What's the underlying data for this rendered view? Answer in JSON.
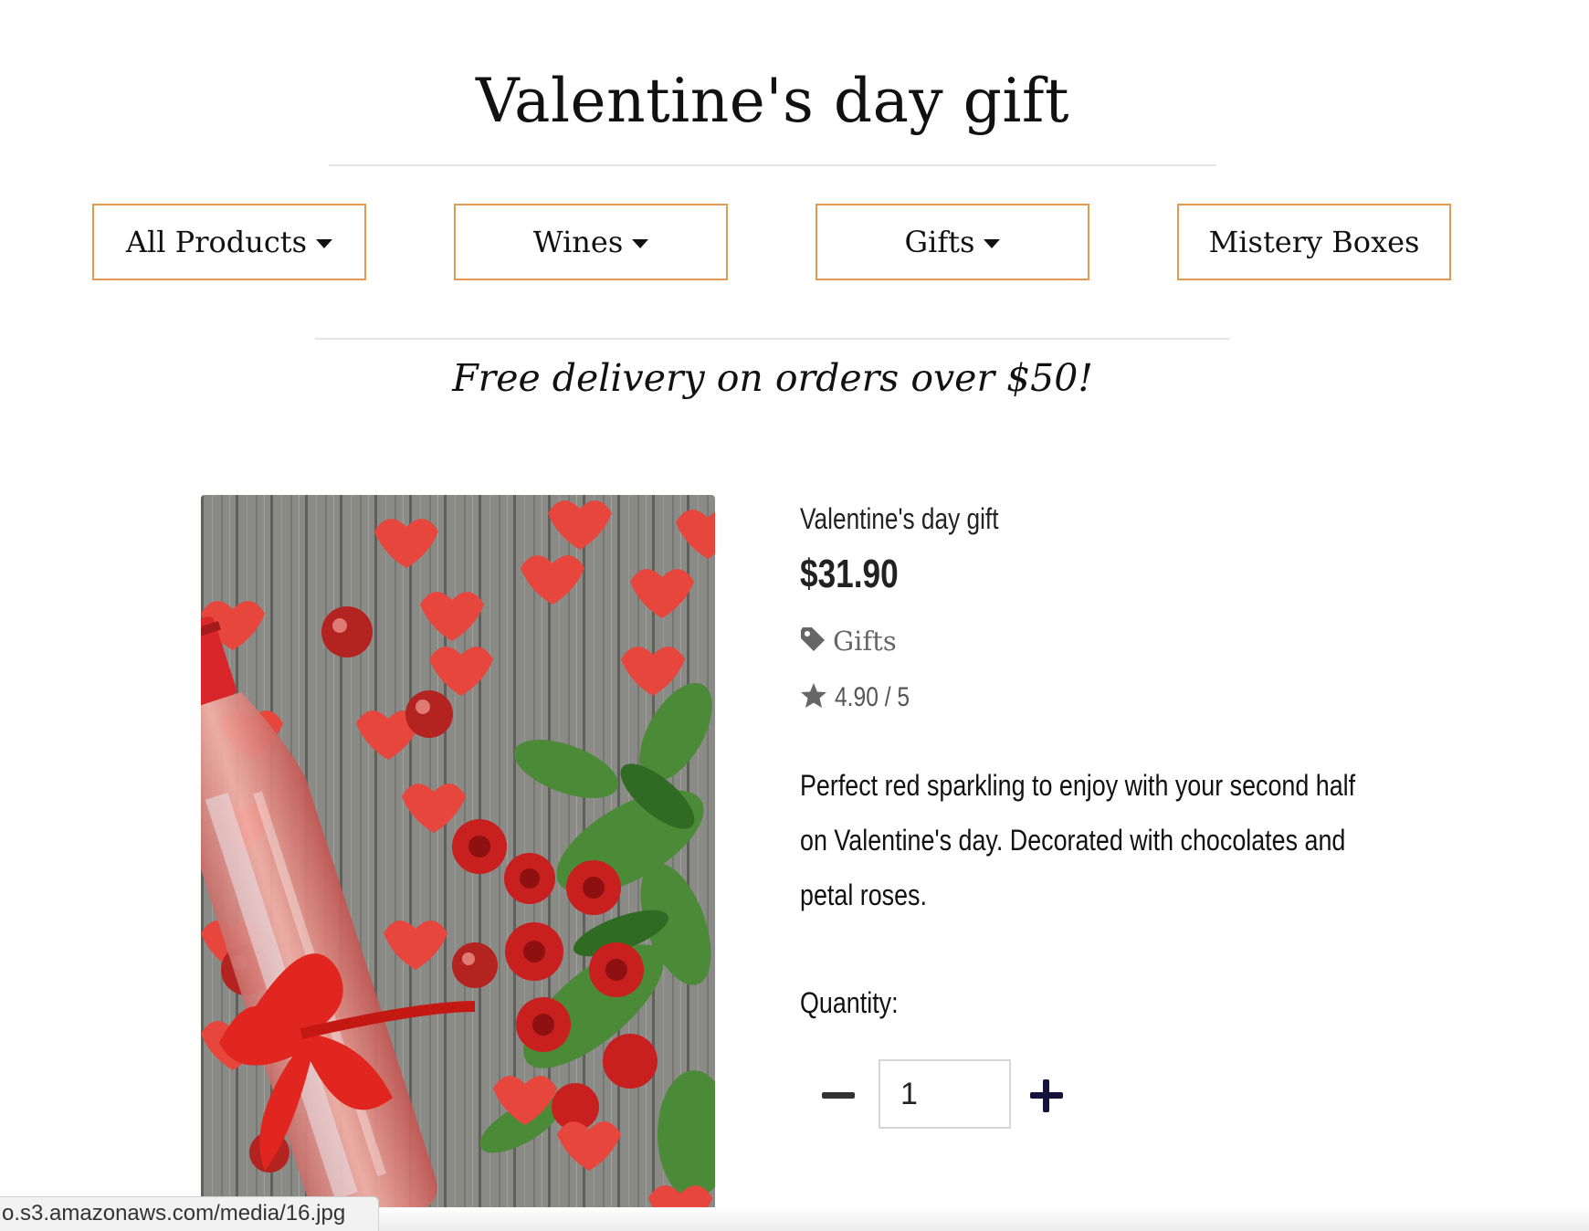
{
  "page": {
    "title": "Valentine's day gift",
    "promo": "Free delivery on orders over $50!"
  },
  "nav": {
    "items": [
      {
        "label": "All Products",
        "has_dropdown": true
      },
      {
        "label": "Wines",
        "has_dropdown": true
      },
      {
        "label": "Gifts",
        "has_dropdown": true
      },
      {
        "label": "Mistery Boxes",
        "has_dropdown": false
      }
    ]
  },
  "product": {
    "name": "Valentine's day gift",
    "price": "$31.90",
    "category": "Gifts",
    "category_icon": "tag-icon",
    "rating": "4.90 / 5",
    "rating_icon": "star-icon",
    "description_lines": [
      "Perfect red sparkling to enjoy with your second half",
      "on Valentine's day. Decorated with chocolates and",
      "petal roses."
    ],
    "quantity_label": "Quantity:",
    "quantity_value": "1"
  },
  "status_bar": {
    "url": "o.s3.amazonaws.com/media/16.jpg"
  },
  "colors": {
    "nav_border": "#e39a4e",
    "text": "#111111",
    "muted": "#666666",
    "plus": "#14143a"
  }
}
